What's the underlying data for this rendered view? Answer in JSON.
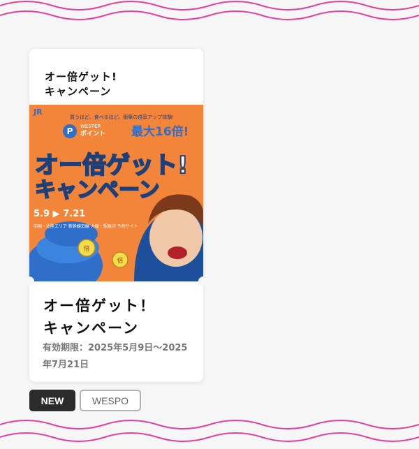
{
  "card": {
    "header": "オー倍ゲット!\nキャンペーン",
    "title": "オー倍ゲット！\nキャンペーン",
    "period": "有効期限：2025年5月9日〜2025年7月21日",
    "banner": {
      "jr_logo": "JR",
      "tagline": "買うほど、食べるほど、衝撃の倍率アップ体験!",
      "wester_line1": "WESTER",
      "wester_line2": "ポイント",
      "multiplier": "最大16倍!",
      "headline1": "オー倍ゲット!",
      "headline2": "キャンペーン",
      "dates": "5.9 ▶ 7.21",
      "area": "中国・北陸エリア 新幹線沿線 大阪・駅周辺 予約サイト",
      "p_badge": "P",
      "coin_text1": "倍",
      "coin_text2": "倍"
    }
  },
  "tags": [
    "NEW",
    "WESPO"
  ],
  "colors": {
    "wave": "#e4409c",
    "banner_orange": "#f3853b",
    "banner_blue": "#2f6fc9",
    "headline_fill": "#ffffff"
  }
}
